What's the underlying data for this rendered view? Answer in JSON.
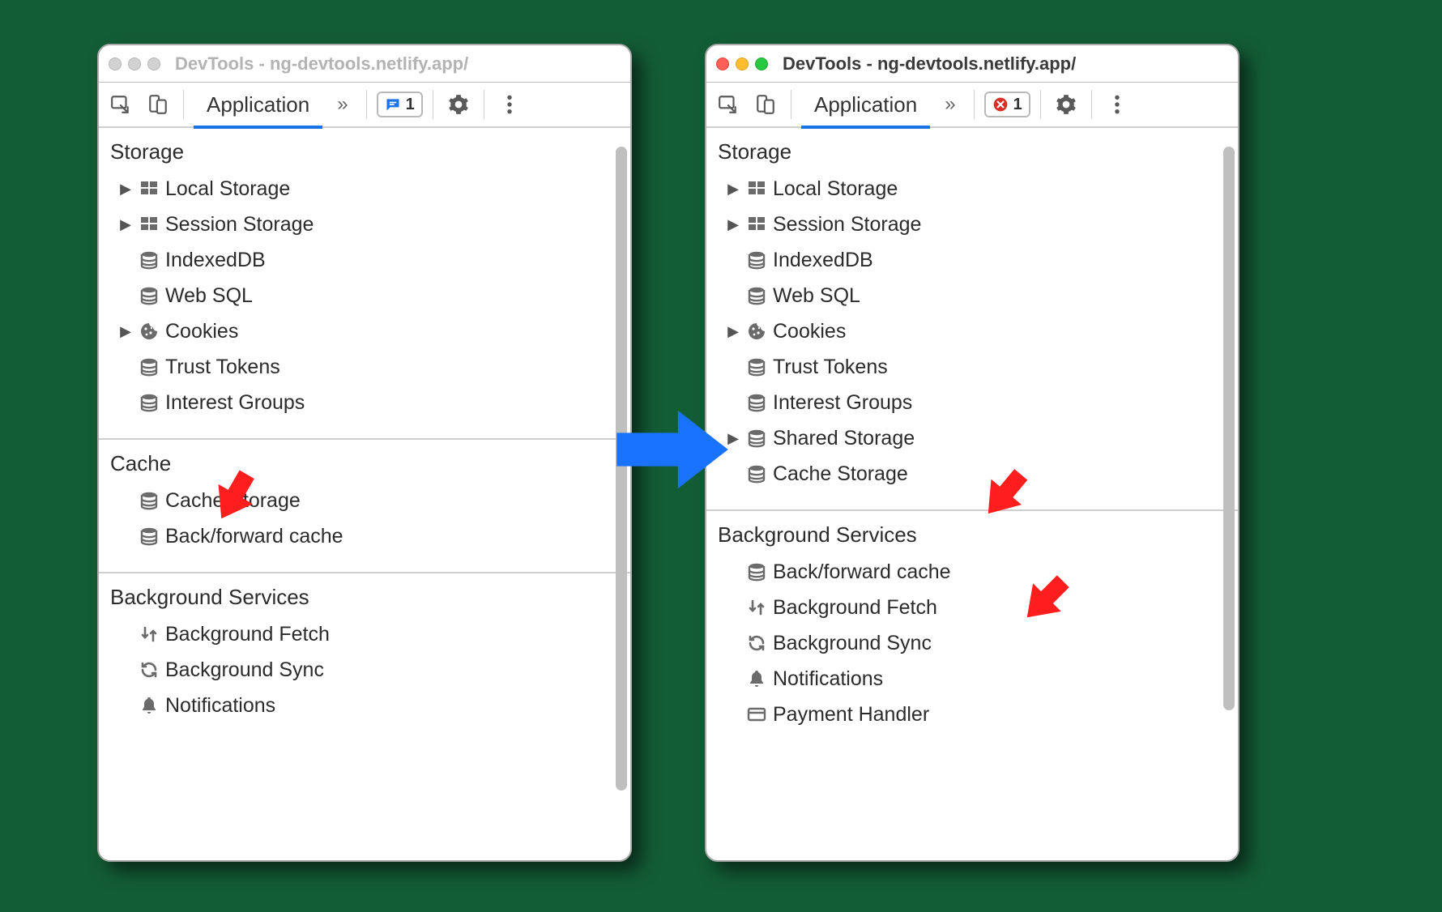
{
  "left": {
    "window_active": false,
    "title": "DevTools - ng-devtools.netlify.app/",
    "tab": "Application",
    "badge": {
      "type": "message",
      "count": "1",
      "color": "#1a73e8"
    },
    "scroll": {
      "top_pct": 12,
      "height_pct": 80
    },
    "sections": [
      {
        "title": "Storage",
        "items": [
          {
            "expand": true,
            "icon": "grid",
            "label": "Local Storage"
          },
          {
            "expand": true,
            "icon": "grid",
            "label": "Session Storage"
          },
          {
            "expand": false,
            "icon": "db",
            "label": "IndexedDB"
          },
          {
            "expand": false,
            "icon": "db",
            "label": "Web SQL"
          },
          {
            "expand": true,
            "icon": "cookie",
            "label": "Cookies"
          },
          {
            "expand": false,
            "icon": "db",
            "label": "Trust Tokens"
          },
          {
            "expand": false,
            "icon": "db",
            "label": "Interest Groups"
          }
        ]
      },
      {
        "title": "Cache",
        "items": [
          {
            "expand": false,
            "icon": "db",
            "label": "Cache Storage"
          },
          {
            "expand": false,
            "icon": "db",
            "label": "Back/forward cache"
          }
        ]
      },
      {
        "title": "Background Services",
        "items": [
          {
            "expand": false,
            "icon": "fetch",
            "label": "Background Fetch"
          },
          {
            "expand": false,
            "icon": "sync",
            "label": "Background Sync"
          },
          {
            "expand": false,
            "icon": "bell",
            "label": "Notifications"
          }
        ]
      }
    ]
  },
  "right": {
    "window_active": true,
    "title": "DevTools - ng-devtools.netlify.app/",
    "tab": "Application",
    "badge": {
      "type": "error",
      "count": "1",
      "color": "#d93025"
    },
    "scroll": {
      "top_pct": 12,
      "height_pct": 70
    },
    "sections": [
      {
        "title": "Storage",
        "items": [
          {
            "expand": true,
            "icon": "grid",
            "label": "Local Storage"
          },
          {
            "expand": true,
            "icon": "grid",
            "label": "Session Storage"
          },
          {
            "expand": false,
            "icon": "db",
            "label": "IndexedDB"
          },
          {
            "expand": false,
            "icon": "db",
            "label": "Web SQL"
          },
          {
            "expand": true,
            "icon": "cookie",
            "label": "Cookies"
          },
          {
            "expand": false,
            "icon": "db",
            "label": "Trust Tokens"
          },
          {
            "expand": false,
            "icon": "db",
            "label": "Interest Groups"
          },
          {
            "expand": true,
            "icon": "db",
            "label": "Shared Storage"
          },
          {
            "expand": false,
            "icon": "db",
            "label": "Cache Storage"
          }
        ]
      },
      {
        "title": "Background Services",
        "items": [
          {
            "expand": false,
            "icon": "db",
            "label": "Back/forward cache"
          },
          {
            "expand": false,
            "icon": "fetch",
            "label": "Background Fetch"
          },
          {
            "expand": false,
            "icon": "sync",
            "label": "Background Sync"
          },
          {
            "expand": false,
            "icon": "bell",
            "label": "Notifications"
          },
          {
            "expand": false,
            "icon": "card",
            "label": "Payment Handler"
          }
        ]
      }
    ]
  }
}
